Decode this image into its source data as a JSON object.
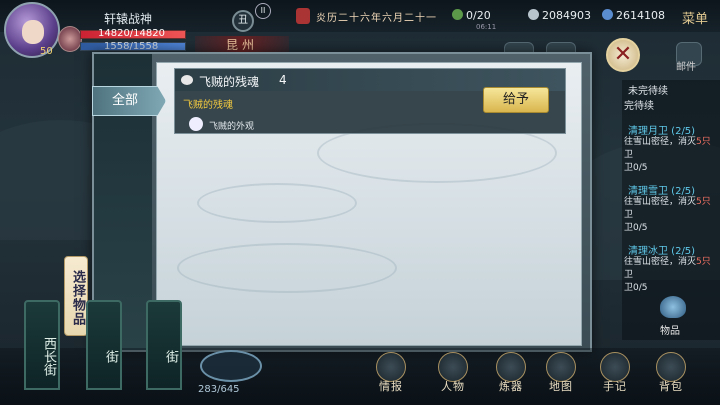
{
  "player": {
    "name": "轩辕战神",
    "level": "50",
    "hp": "14820/14820",
    "mp": "1558/1558",
    "hp_fraction": 1.0,
    "mp_fraction": 1.0
  },
  "header": {
    "zodiac": "丑",
    "pause": "II",
    "location": "昆州",
    "calendar": "炎历二十六年六月二十一",
    "resource1": "0/20",
    "time": "06:11",
    "resource2": "2084903",
    "resource3": "2614108",
    "menu": "菜单"
  },
  "right_panel": {
    "close": "✕",
    "mail": "邮件",
    "task_header_1": "未完待续",
    "task_header_2": "完待续",
    "tasks": [
      {
        "title": "清理月卫 (2/5)",
        "desc_a": "往雪山密径，消灭",
        "desc_b": "5只",
        "desc_c": "卫",
        "progress": "卫0/5"
      },
      {
        "title": "清理雪卫 (2/5)",
        "desc_a": "往雪山密径，消灭",
        "desc_b": "5只",
        "desc_c": "卫",
        "progress": "卫0/5"
      },
      {
        "title": "清理冰卫 (2/5)",
        "desc_a": "往雪山密径，消灭",
        "desc_b": "5只",
        "desc_c": "卫",
        "progress": "卫0/5"
      }
    ],
    "items_label": "物品"
  },
  "dialog": {
    "tab_all": "全部",
    "select_label": "选择物品",
    "item": {
      "name": "飞贼的残魂",
      "count": "4",
      "subtitle": "飞贼的残魂",
      "look": "飞贼的外观",
      "give": "给予"
    }
  },
  "bottom": {
    "streets": [
      "西长街",
      "街",
      "街"
    ],
    "stamina": "283/645",
    "nav": [
      "情报",
      "人物",
      "炼器",
      "地图",
      "手记",
      "背包"
    ]
  },
  "colors": {
    "accent_gold": "#f0c840",
    "task_title": "#5fc8e8",
    "task_red": "#f07060"
  }
}
